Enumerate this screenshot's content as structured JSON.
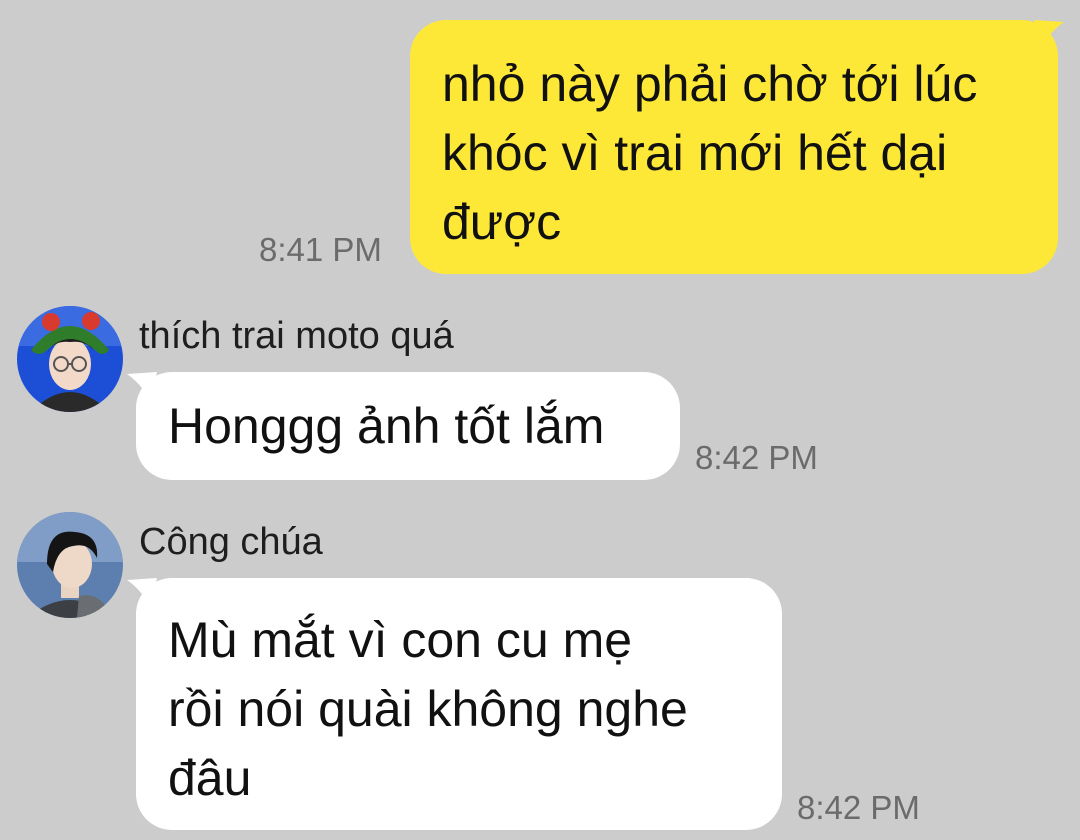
{
  "theme": {
    "background": "#cccccc",
    "outgoing_bubble": "#fee837",
    "incoming_bubble": "#ffffff",
    "timestamp_color": "#6b6b6b"
  },
  "messages": [
    {
      "direction": "outgoing",
      "text": "nhỏ này phải chờ tới lúc\nkhóc vì trai mới hết dại\nđược",
      "time": "8:41 PM"
    },
    {
      "direction": "incoming",
      "sender": "thích trai moto quá",
      "avatar_icon": "user-avatar-green-hat-icon",
      "text": "Honggg ảnh tốt lắm",
      "time": "8:42 PM"
    },
    {
      "direction": "incoming",
      "sender": "Công chúa",
      "avatar_icon": "user-avatar-dark-hair-icon",
      "text": "Mù mắt vì con cu mẹ\nrồi nói quài không nghe\nđâu",
      "time": "8:42 PM"
    }
  ]
}
